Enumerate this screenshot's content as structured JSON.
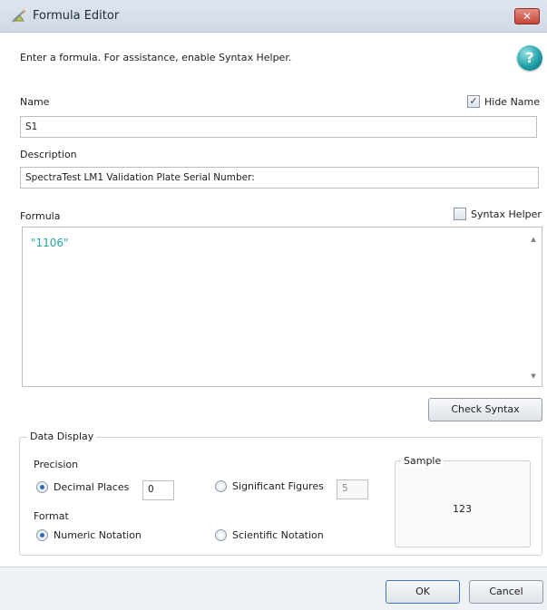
{
  "window": {
    "title": "Formula Editor",
    "close_label": "✕",
    "instructions": "Enter a formula. For assistance, enable Syntax Helper.",
    "help_label": "?"
  },
  "name_field": {
    "label": "Name",
    "value": "S1",
    "hide_name_label": "Hide Name",
    "hide_name_checked": true
  },
  "description_field": {
    "label": "Description",
    "value": "SpectraTest LM1 Validation Plate Serial Number:"
  },
  "formula": {
    "label": "Formula",
    "syntax_helper_label": "Syntax Helper",
    "syntax_helper_checked": false,
    "value": "\"1106\"",
    "check_syntax_label": "Check Syntax"
  },
  "data_display": {
    "title": "Data Display",
    "precision_label": "Precision",
    "decimal_places_label": "Decimal Places",
    "decimal_places_value": "0",
    "significant_figures_label": "Significant Figures",
    "significant_figures_value": "5",
    "format_label": "Format",
    "numeric_notation_label": "Numeric Notation",
    "scientific_notation_label": "Scientific Notation",
    "sample_label": "Sample",
    "sample_value": "123"
  },
  "footer": {
    "ok_label": "OK",
    "cancel_label": "Cancel"
  }
}
